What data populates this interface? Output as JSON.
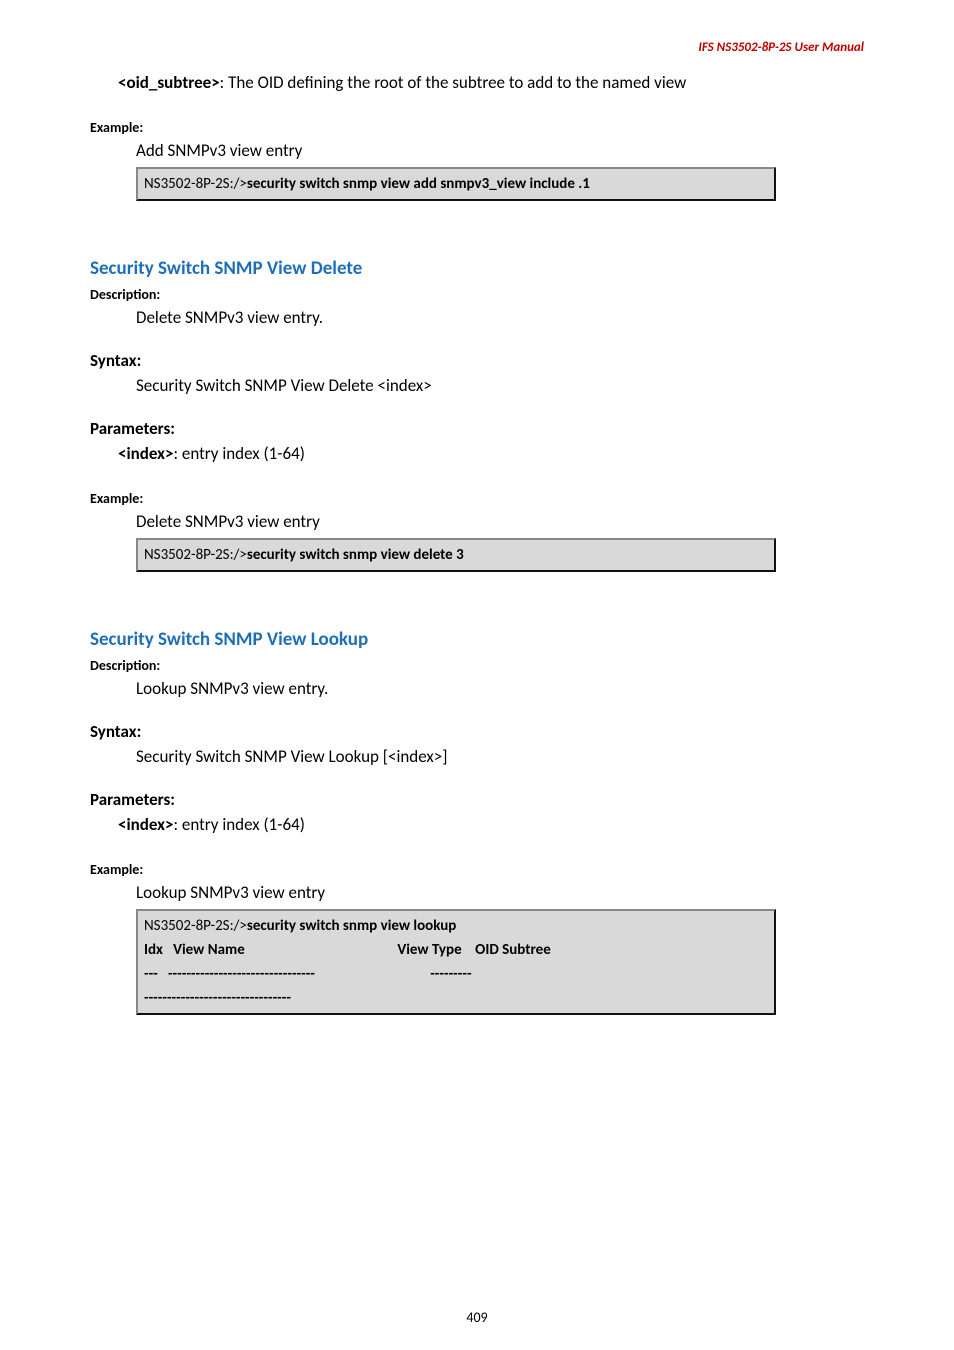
{
  "header": {
    "right": "IFS  NS3502-8P-2S  User  Manual"
  },
  "intro": {
    "param_name": "<oid_subtree>",
    "param_desc": ": The OID defining the root of the subtree to add to the named view"
  },
  "example1": {
    "label": "Example:",
    "desc": "Add SNMPv3 view entry",
    "prompt": "NS3502-8P-2S:/>",
    "cmd": "security switch snmp view add snmpv3_view include .1"
  },
  "section_delete": {
    "title": "Security Switch SNMP View Delete",
    "desc_label": "Description:",
    "desc_text": "Delete SNMPv3 view entry.",
    "syntax_label": "Syntax:",
    "syntax_text": "Security Switch SNMP View Delete <index>",
    "params_label": "Parameters:",
    "param_name": "<index>",
    "param_desc": ": entry index (1-64)",
    "example_label": "Example:",
    "example_desc": "Delete SNMPv3 view entry",
    "prompt": "NS3502-8P-2S:/>",
    "cmd": "security switch snmp view delete 3"
  },
  "section_lookup": {
    "title": "Security Switch SNMP View Lookup",
    "desc_label": "Description:",
    "desc_text": "Lookup SNMPv3 view entry.",
    "syntax_label": "Syntax:",
    "syntax_text": "Security Switch SNMP View Lookup [<index>]",
    "params_label": "Parameters:",
    "param_name": "<index>",
    "param_desc": ": entry index (1-64)",
    "example_label": "Example:",
    "example_desc": "Lookup SNMPv3 view entry",
    "prompt": "NS3502-8P-2S:/>",
    "cmd": "security switch snmp view lookup",
    "header_row": "Idx   View Name                                             View Type    OID Subtree",
    "dash_row1": "---   --------------------------------                                  ---------  ",
    "dash_row2": "--------------------------------"
  },
  "footer": {
    "page": "409"
  }
}
